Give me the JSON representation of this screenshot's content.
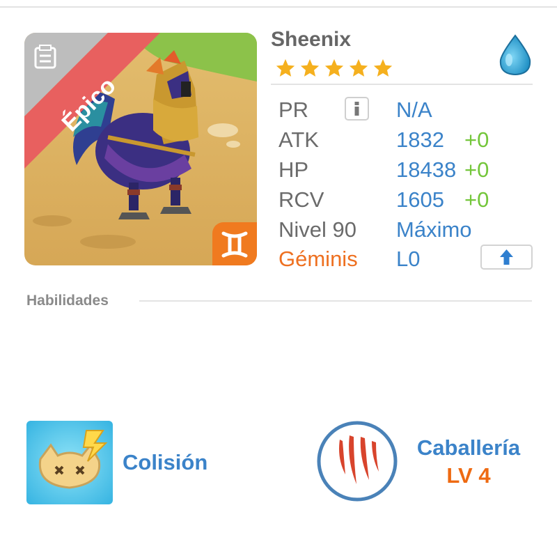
{
  "unit": {
    "name": "Sheenix",
    "rarity": "Épico",
    "stars": 5,
    "element_icon": "water-drop-icon",
    "zodiac_icon": "gemini-icon"
  },
  "stats": [
    {
      "label": "PR",
      "value": "N/A",
      "bonus": ""
    },
    {
      "label": "ATK",
      "value": "1832",
      "bonus": "+0"
    },
    {
      "label": "HP",
      "value": "18438",
      "bonus": "+0"
    },
    {
      "label": "RCV",
      "value": "1605",
      "bonus": "+0"
    },
    {
      "label": "Nivel 90",
      "value": "Máximo",
      "bonus": ""
    },
    {
      "label": "Géminis",
      "value": "L0",
      "bonus": ""
    }
  ],
  "abilities": {
    "title": "Habilidades",
    "skill": {
      "name": "Colisión",
      "icon": "collision-skill-icon"
    },
    "class": {
      "name": "Caballería",
      "level": "LV 4",
      "icon": "claw-marks-icon"
    }
  },
  "colors": {
    "accent_blue": "#3b83c9",
    "bonus_green": "#74c63b",
    "zodiac_orange": "#ee7020",
    "rarity_red": "#e8605f"
  }
}
